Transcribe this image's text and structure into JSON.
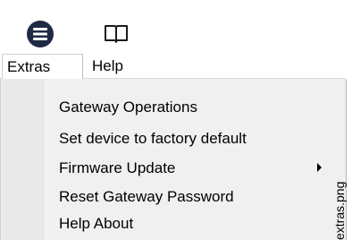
{
  "toolbar": {
    "menu_icon": "hamburger-menu-icon",
    "help_icon": "open-book-icon",
    "menu_icon_color": "#1f2a44"
  },
  "menubar": {
    "tabs": [
      {
        "label": "Extras"
      },
      {
        "label": "Help"
      }
    ]
  },
  "dropdown": {
    "items": [
      {
        "label": "Gateway Operations"
      },
      {
        "label": "Set device to factory default"
      },
      {
        "label": "Firmware Update",
        "has_submenu": true
      },
      {
        "label": "Reset Gateway Password"
      },
      {
        "label": "Help About"
      }
    ]
  },
  "caption": {
    "text": "extras.png"
  }
}
